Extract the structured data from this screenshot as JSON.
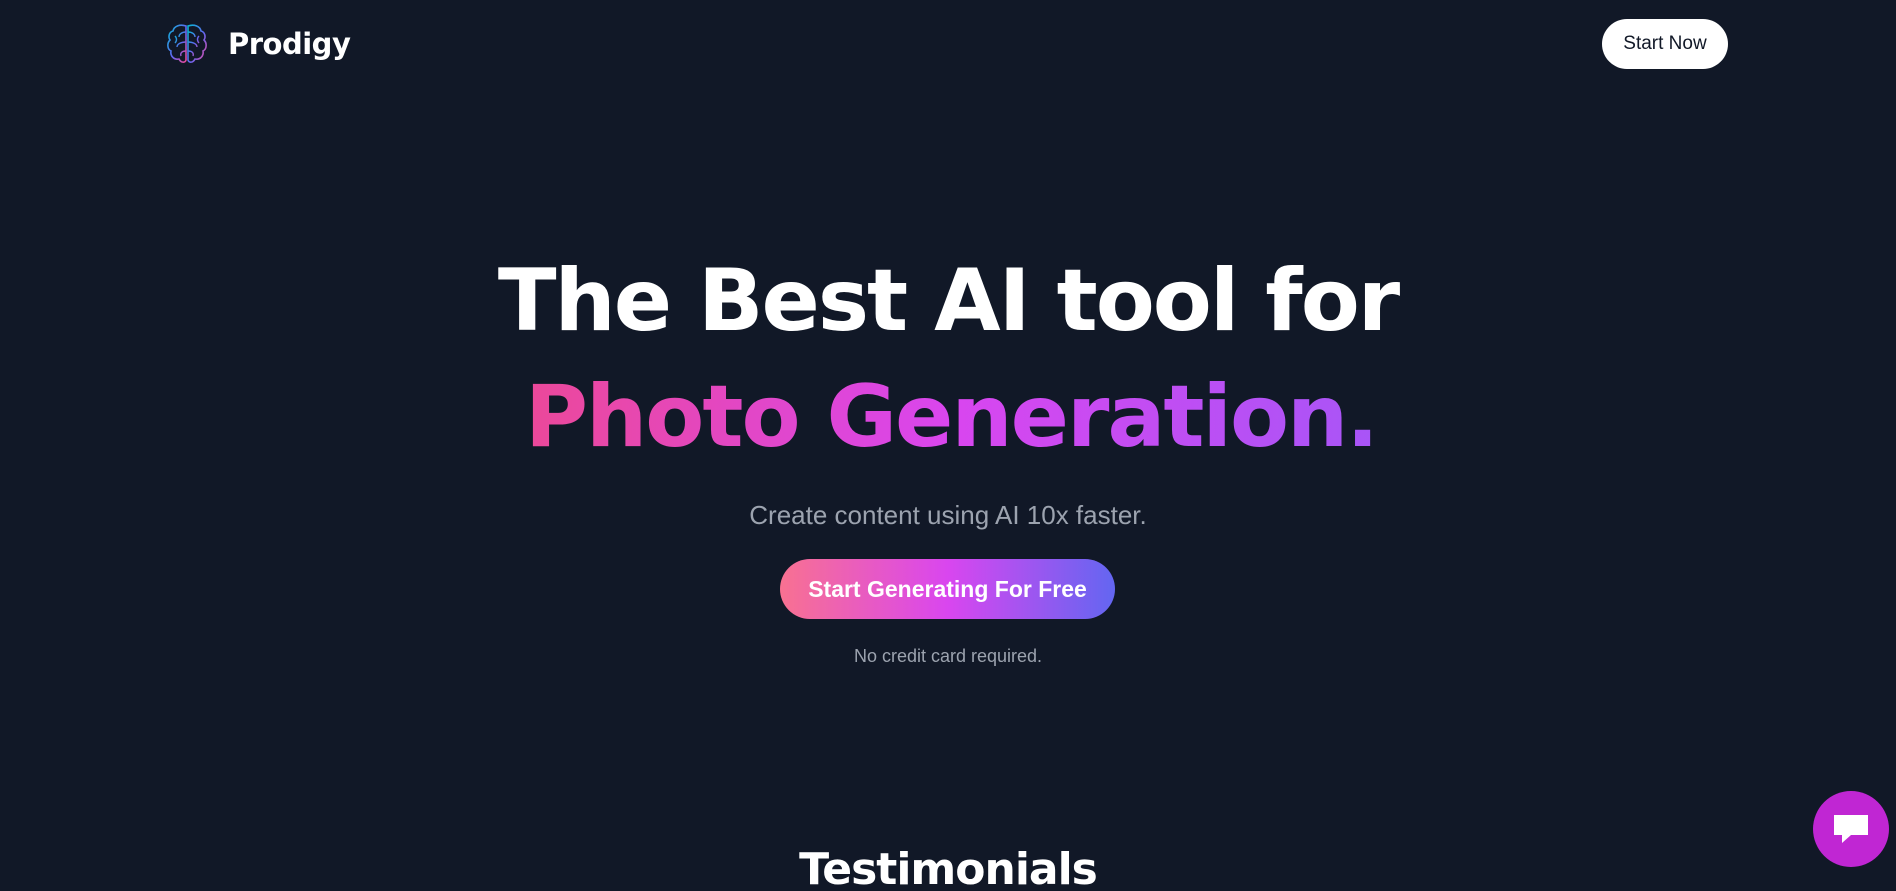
{
  "header": {
    "brand": "Prodigy",
    "logo_icon": "brain-icon",
    "start_now_label": "Start Now"
  },
  "hero": {
    "title_line1": "The Best AI tool for",
    "title_line2": "Photo Generation.",
    "subtitle": "Create content using AI 10x faster.",
    "cta_label": "Start Generating For Free",
    "note": "No credit card required."
  },
  "sections": {
    "testimonials_heading": "Testimonials"
  },
  "chat_widget": {
    "icon": "chat-icon"
  },
  "colors": {
    "background": "#111827",
    "accent_pink": "#ec4899",
    "accent_magenta": "#d946ef",
    "accent_purple": "#a855f7",
    "accent_indigo": "#6366f1",
    "chat_bubble": "#c026d3"
  }
}
